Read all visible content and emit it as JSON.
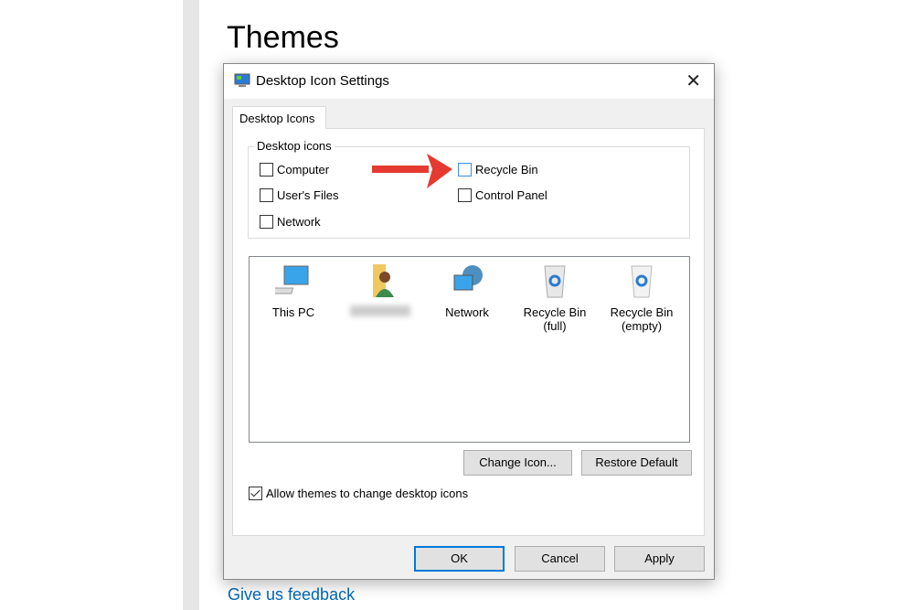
{
  "page": {
    "title": "Themes",
    "feedback_link": "Give us feedback"
  },
  "dialog": {
    "title": "Desktop Icon Settings",
    "tab": "Desktop Icons",
    "group_label": "Desktop icons",
    "checkboxes": [
      {
        "label": "Computer",
        "checked": false
      },
      {
        "label": "User's Files",
        "checked": false
      },
      {
        "label": "Network",
        "checked": false
      },
      {
        "label": "Recycle Bin",
        "checked": false
      },
      {
        "label": "Control Panel",
        "checked": false
      }
    ],
    "icons": [
      {
        "label": "This PC",
        "icon": "monitor-icon"
      },
      {
        "label": "",
        "icon": "user-folder-icon"
      },
      {
        "label": "Network",
        "icon": "network-icon"
      },
      {
        "label": "Recycle Bin\n(full)",
        "line1": "Recycle Bin",
        "line2": "(full)",
        "icon": "recycle-bin-full-icon"
      },
      {
        "label": "Recycle Bin\n(empty)",
        "line1": "Recycle Bin",
        "line2": "(empty)",
        "icon": "recycle-bin-empty-icon"
      }
    ],
    "change_icon": "Change Icon...",
    "restore_default": "Restore Default",
    "allow_themes": {
      "label": "Allow themes to change desktop icons",
      "checked": true
    },
    "ok": "OK",
    "cancel": "Cancel",
    "apply": "Apply",
    "close": "✕"
  },
  "colors": {
    "accent": "#0078d7",
    "arrow": "#e53a2f",
    "link": "#0067b8"
  }
}
